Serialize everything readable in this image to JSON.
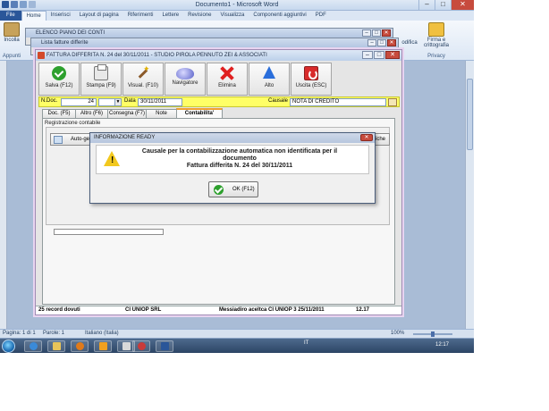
{
  "word": {
    "title": "Documento1 - Microsoft Word",
    "tabs": [
      "File",
      "Home",
      "Inserisci",
      "Layout di pagina",
      "Riferimenti",
      "Lettere",
      "Revisione",
      "Visualizza",
      "Componenti aggiuntivi",
      "PDF"
    ],
    "ribbon": {
      "paste_label": "Incolla",
      "clipboard_group": "Appunti",
      "edit_label": "odifica",
      "sign_label": "Firma e\ncrittografia",
      "privacy_group": "Privacy"
    },
    "status": {
      "page": "Pagina: 1 di 1",
      "words": "Parole: 1",
      "language": "Italiano (Italia)",
      "zoom": "100%"
    }
  },
  "bg_windows": {
    "elenco_title": "ELENCO PIANO DEI CONTI",
    "lista_title": "Lista fatture differite"
  },
  "main": {
    "title": "FATTURA DIFFERITA N. 24  del 30/11/2011 - STUDIO PIROLA PENNUTO ZEI & ASSOCIATI",
    "toolbar": [
      {
        "id": "save",
        "label": "Salva (F12)"
      },
      {
        "id": "print",
        "label": "Stampa (F9)"
      },
      {
        "id": "view",
        "label": "Visual. (F10)"
      },
      {
        "id": "nav",
        "label": "Navigatore"
      },
      {
        "id": "delete",
        "label": "Elimina"
      },
      {
        "id": "up",
        "label": "Alto"
      },
      {
        "id": "exit",
        "label": "Uscita (ESC)"
      }
    ],
    "docrow": {
      "ndoc_label": "N.Doc.",
      "ndoc_value": "24",
      "data_label": "Data",
      "data_value": "30/11/2011",
      "causale_label": "Causale",
      "causale_value": "NOTA DI CREDITO"
    },
    "tabs": [
      {
        "label": "Doc. (F5)",
        "active": false
      },
      {
        "label": "Altro (F6)",
        "active": false
      },
      {
        "label": "Consegna (F7)",
        "active": false
      },
      {
        "label": "Note",
        "active": false
      },
      {
        "label": "Contabilita'",
        "active": true
      }
    ],
    "registrazione_label": "Registrazione contabile",
    "auto_button": "Auto-ge",
    "right_button": "fiche",
    "list_row": {
      "c1": "25 record dovuti",
      "c2": "CI UNIOP  SRL",
      "c3": "Messiadiro aceltca   CI UNIOP  3  25/11/2011",
      "c4": "12.17"
    }
  },
  "dialog": {
    "title": "INFORMAZIONE READY",
    "line1": "Causale per la contabilizzazione automatica non identificata per il",
    "line2": "documento",
    "line3": "Fattura differita N. 24 del 30/11/2011",
    "ok_label": "OK (F12)"
  },
  "taskbar": {
    "tray_lang": "IT",
    "clock": "12:17"
  },
  "colors": {
    "docrow_bg": "#ffff66",
    "warning": "#f2c81e",
    "ok_green": "#2da02d",
    "close_red": "#c74b3d"
  }
}
